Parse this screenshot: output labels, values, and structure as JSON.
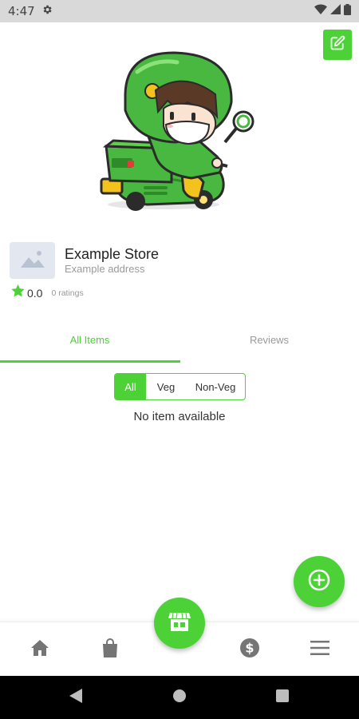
{
  "status_bar": {
    "time": "4:47"
  },
  "store": {
    "name": "Example Store",
    "address": "Example address",
    "rating": "0.0",
    "rating_count": "0 ratings"
  },
  "tabs": [
    {
      "label": "All Items",
      "active": true
    },
    {
      "label": "Reviews",
      "active": false
    }
  ],
  "filter": {
    "options": [
      "All",
      "Veg",
      "Non-Veg"
    ],
    "selected": "All"
  },
  "empty_message": "No item available",
  "bottom_nav": {
    "items": [
      "home-icon",
      "bag-icon",
      "store-icon",
      "dollar-icon",
      "menu-icon"
    ],
    "active": "store-icon"
  },
  "colors": {
    "accent": "#4cd137",
    "status_bar": "#d9d9d9",
    "text_muted": "#9a9a9a"
  }
}
